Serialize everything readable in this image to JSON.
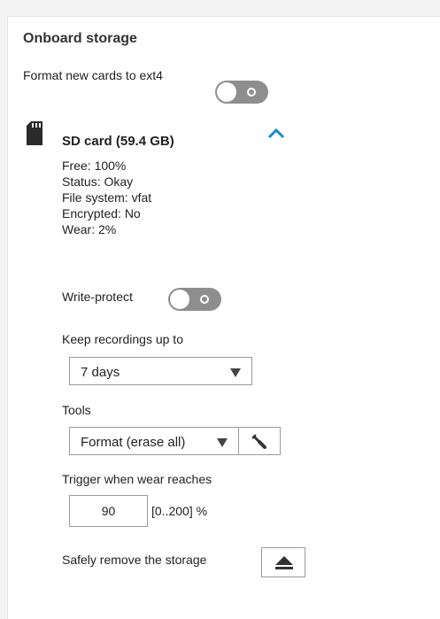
{
  "section": {
    "title": "Onboard storage",
    "format_label": "Format new cards to ext4",
    "format_toggle_state": "off"
  },
  "card": {
    "icon": "sd-card-icon",
    "title": "SD card (59.4 GB)",
    "info": {
      "free": "Free: 100%",
      "status": "Status: Okay",
      "filesystem": "File system: vfat",
      "encrypted": "Encrypted: No",
      "wear": "Wear: 2%"
    },
    "write_protect_label": "Write-protect",
    "write_protect_state": "off",
    "keep_label": "Keep recordings up to",
    "keep_value": "7 days",
    "tools_label": "Tools",
    "tools_value": "Format (erase all)",
    "trigger_label": "Trigger when wear reaches",
    "trigger_value": "90",
    "trigger_range": "[0..200] %",
    "remove_label": "Safely remove the storage"
  },
  "colors": {
    "toggle_off": "#8e8e8e",
    "chevron": "#1a8fc5"
  }
}
